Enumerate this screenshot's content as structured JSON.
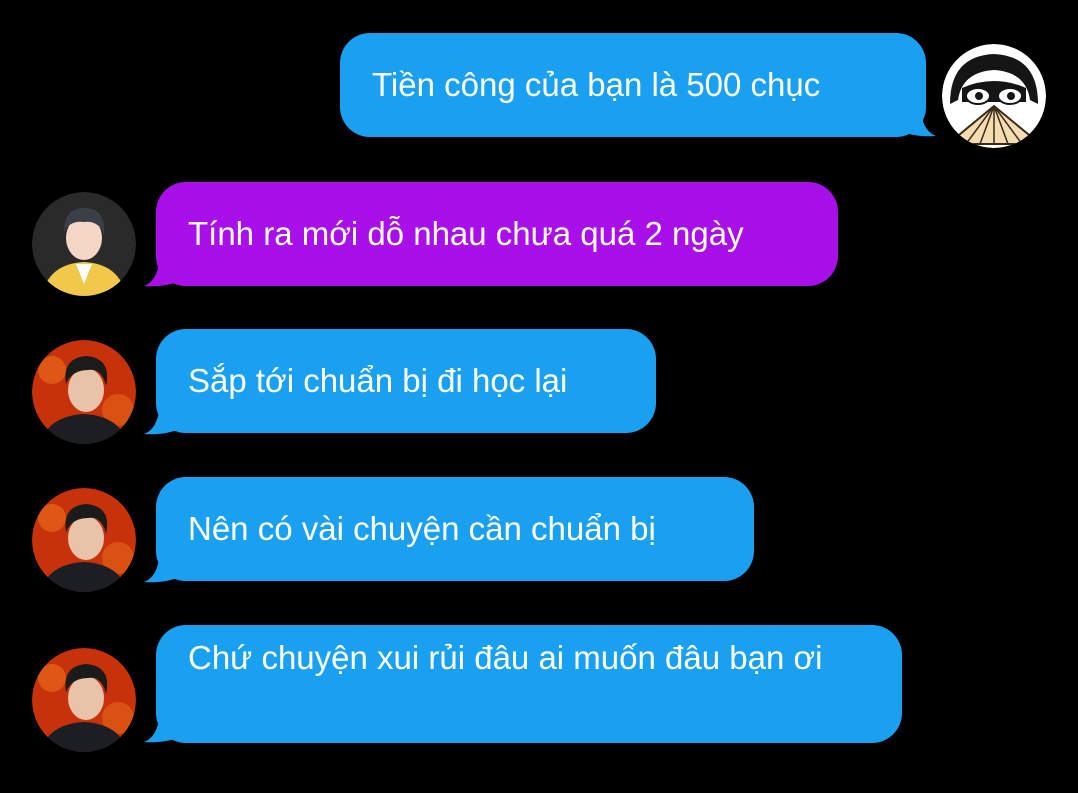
{
  "colors": {
    "background": "#000000",
    "sent_bubble": "#1aa0f0",
    "received_bubble_purple": "#a90fe8",
    "received_bubble_blue": "#1aa0f0",
    "text": "#ffffff"
  },
  "messages": [
    {
      "direction": "outgoing",
      "text": "Tiền công của bạn là 500 chục",
      "bubble_color": "#1aa0f0",
      "avatar_icon": "fan-girl-cartoon-avatar"
    },
    {
      "direction": "incoming",
      "text": "Tính ra mới dỗ nhau chưa quá 2 ngày",
      "bubble_color": "#a90fe8",
      "avatar_icon": "boy-yellow-jacket-avatar"
    },
    {
      "direction": "incoming",
      "text": "Sắp tới chuẩn bị đi học lại",
      "bubble_color": "#1aa0f0",
      "avatar_icon": "boy-red-background-avatar"
    },
    {
      "direction": "incoming",
      "text": "Nên có vài chuyện cần chuẩn bị",
      "bubble_color": "#1aa0f0",
      "avatar_icon": "boy-red-background-avatar"
    },
    {
      "direction": "incoming",
      "text": "Chứ chuyện xui rủi đâu ai muốn đâu bạn ơi",
      "bubble_color": "#1aa0f0",
      "avatar_icon": "boy-red-background-avatar"
    }
  ]
}
